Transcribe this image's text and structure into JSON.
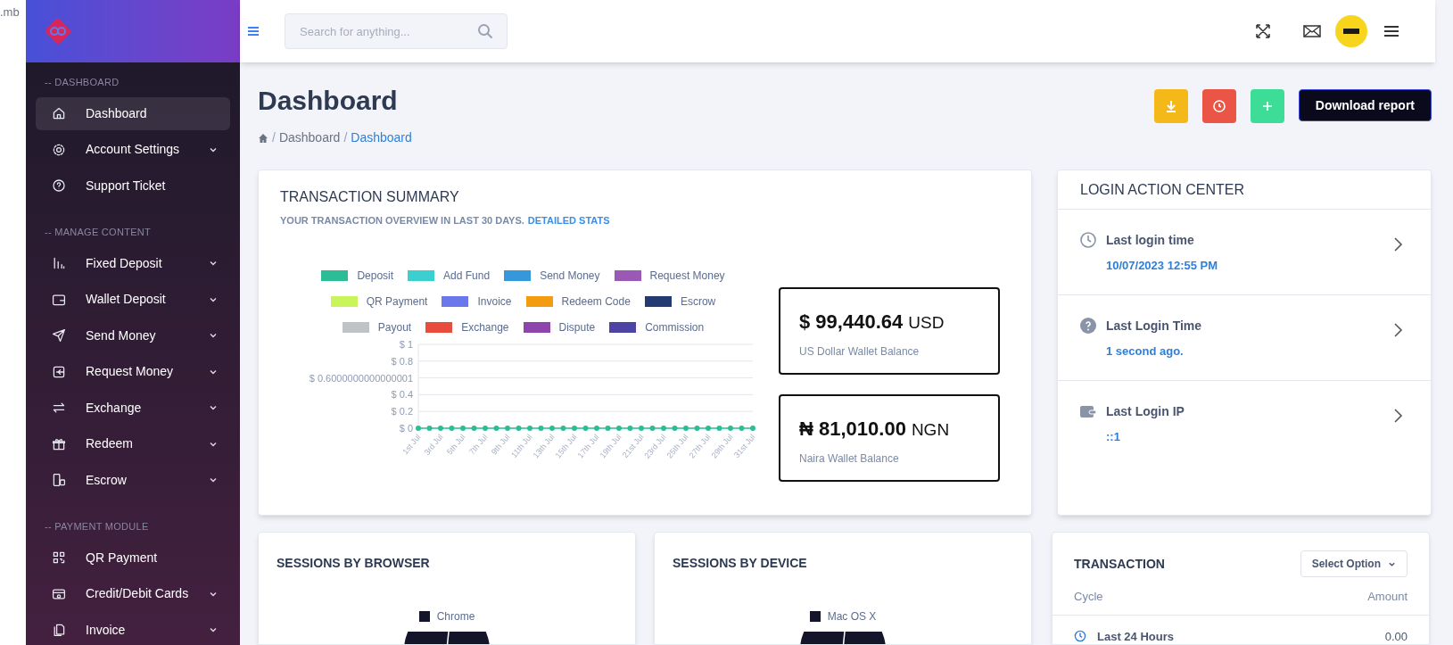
{
  "background_window": {
    "text": ".mb"
  },
  "sidebar": {
    "sections": [
      {
        "heading": "-- DASHBOARD",
        "items": [
          {
            "label": "Dashboard",
            "kind": "home",
            "selected": true,
            "has_submenu": false
          },
          {
            "label": "Account Settings",
            "kind": "gear",
            "selected": false,
            "has_submenu": true
          },
          {
            "label": "Support Ticket",
            "kind": "question",
            "selected": false,
            "has_submenu": false
          }
        ]
      },
      {
        "heading": "-- MANAGE CONTENT",
        "items": [
          {
            "label": "Fixed Deposit",
            "kind": "bars",
            "selected": false,
            "has_submenu": true
          },
          {
            "label": "Wallet Deposit",
            "kind": "wallet",
            "selected": false,
            "has_submenu": true
          },
          {
            "label": "Send Money",
            "kind": "send",
            "selected": false,
            "has_submenu": true
          },
          {
            "label": "Request Money",
            "kind": "request",
            "selected": false,
            "has_submenu": true
          },
          {
            "label": "Exchange",
            "kind": "exchange",
            "selected": false,
            "has_submenu": true
          },
          {
            "label": "Redeem",
            "kind": "gift",
            "selected": false,
            "has_submenu": true
          },
          {
            "label": "Escrow",
            "kind": "escrow",
            "selected": false,
            "has_submenu": true
          }
        ]
      },
      {
        "heading": "-- PAYMENT MODULE",
        "items": [
          {
            "label": "QR Payment",
            "kind": "qr",
            "selected": false,
            "has_submenu": false
          },
          {
            "label": "Credit/Debit Cards",
            "kind": "card",
            "selected": false,
            "has_submenu": true
          },
          {
            "label": "Invoice",
            "kind": "invoice",
            "selected": false,
            "has_submenu": true
          }
        ]
      }
    ]
  },
  "header": {
    "search": {
      "placeholder": "Search for anything..."
    }
  },
  "page": {
    "title": "Dashboard",
    "breadcrumb": [
      {
        "separator": "/",
        "label": "Dashboard"
      },
      {
        "separator": "/",
        "label": "Dashboard"
      }
    ],
    "action_buttons": [
      {
        "kind": "download",
        "color": "#f5b819"
      },
      {
        "kind": "clock",
        "color": "#ea5545"
      },
      {
        "kind": "plus",
        "color": "#3ddc97"
      }
    ],
    "report_button": "Download report"
  },
  "transaction_summary": {
    "title": "TRANSACTION SUMMARY",
    "subtitle": "YOUR TRANSACTION OVERVIEW IN LAST 30 DAYS.",
    "link": "DETAILED STATS",
    "chart_data": {
      "type": "line",
      "categories": [
        "1st Jul",
        null,
        "3rd Jul",
        null,
        "5th Jul",
        null,
        "7th Jul",
        null,
        "9th Jul",
        null,
        "11th Jul",
        null,
        "13th Jul",
        null,
        "15th Jul",
        null,
        "17th Jul",
        null,
        "19th Jul",
        null,
        "21st Jul",
        null,
        "23rd Jul",
        null,
        "25th Jul",
        null,
        "27th Jul",
        null,
        "29th Jul",
        null,
        "31st Jul"
      ],
      "ylim": [
        0,
        1
      ],
      "yticks": [
        {
          "value": 1,
          "label": "$ 1"
        },
        {
          "value": 0.8,
          "label": "$ 0.8"
        },
        {
          "value": 0.6,
          "label": "$ 0.6000000000000001"
        },
        {
          "value": 0.4,
          "label": "$ 0.4"
        },
        {
          "value": 0.2,
          "label": "$ 0.2"
        },
        {
          "value": 0,
          "label": "$ 0"
        }
      ],
      "series": [
        {
          "name": "Deposit",
          "color": "#2dbd96",
          "marker": "circle",
          "values": [
            0,
            0,
            0,
            0,
            0,
            0,
            0,
            0,
            0,
            0,
            0,
            0,
            0,
            0,
            0,
            0,
            0,
            0,
            0,
            0,
            0,
            0,
            0,
            0,
            0,
            0,
            0,
            0,
            0,
            0,
            0
          ]
        },
        {
          "name": "Add Fund",
          "color": "#3ccfcf",
          "values": [
            null,
            null,
            null,
            null,
            null,
            null,
            null,
            null,
            null,
            null,
            null,
            null,
            null,
            null,
            null,
            null,
            null,
            null,
            null,
            null,
            null,
            null,
            null,
            null,
            null,
            null,
            null,
            null,
            null,
            null,
            null
          ]
        },
        {
          "name": "Send Money",
          "color": "#3498db",
          "values": [
            null,
            null,
            null,
            null,
            null,
            null,
            null,
            null,
            null,
            null,
            null,
            null,
            null,
            null,
            null,
            null,
            null,
            null,
            null,
            null,
            null,
            null,
            null,
            null,
            null,
            null,
            null,
            null,
            null,
            null,
            null
          ]
        },
        {
          "name": "Request Money",
          "color": "#9b59b6",
          "values": [
            null,
            null,
            null,
            null,
            null,
            null,
            null,
            null,
            null,
            null,
            null,
            null,
            null,
            null,
            null,
            null,
            null,
            null,
            null,
            null,
            null,
            null,
            null,
            null,
            null,
            null,
            null,
            null,
            null,
            null,
            null
          ]
        },
        {
          "name": "QR Payment",
          "color": "#c9f55b",
          "values": [
            null,
            null,
            null,
            null,
            null,
            null,
            null,
            null,
            null,
            null,
            null,
            null,
            null,
            null,
            null,
            null,
            null,
            null,
            null,
            null,
            null,
            null,
            null,
            null,
            null,
            null,
            null,
            null,
            null,
            null,
            null
          ]
        },
        {
          "name": "Invoice",
          "color": "#6a78ec",
          "values": [
            null,
            null,
            null,
            null,
            null,
            null,
            null,
            null,
            null,
            null,
            null,
            null,
            null,
            null,
            null,
            null,
            null,
            null,
            null,
            null,
            null,
            null,
            null,
            null,
            null,
            null,
            null,
            null,
            null,
            null,
            null
          ]
        },
        {
          "name": "Redeem Code",
          "color": "#f39c12",
          "values": [
            null,
            null,
            null,
            null,
            null,
            null,
            null,
            null,
            null,
            null,
            null,
            null,
            null,
            null,
            null,
            null,
            null,
            null,
            null,
            null,
            null,
            null,
            null,
            null,
            null,
            null,
            null,
            null,
            null,
            null,
            null
          ]
        },
        {
          "name": "Escrow",
          "color": "#233b70",
          "values": [
            null,
            null,
            null,
            null,
            null,
            null,
            null,
            null,
            null,
            null,
            null,
            null,
            null,
            null,
            null,
            null,
            null,
            null,
            null,
            null,
            null,
            null,
            null,
            null,
            null,
            null,
            null,
            null,
            null,
            null,
            null
          ]
        },
        {
          "name": "Payout",
          "color": "#bdc3c7",
          "values": [
            null,
            null,
            null,
            null,
            null,
            null,
            null,
            null,
            null,
            null,
            null,
            null,
            null,
            null,
            null,
            null,
            null,
            null,
            null,
            null,
            null,
            null,
            null,
            null,
            null,
            null,
            null,
            null,
            null,
            null,
            null
          ]
        },
        {
          "name": "Exchange",
          "color": "#e74c3c",
          "values": [
            null,
            null,
            null,
            null,
            null,
            null,
            null,
            null,
            null,
            null,
            null,
            null,
            null,
            null,
            null,
            null,
            null,
            null,
            null,
            null,
            null,
            null,
            null,
            null,
            null,
            null,
            null,
            null,
            null,
            null,
            null
          ]
        },
        {
          "name": "Dispute",
          "color": "#8e44ad",
          "values": [
            null,
            null,
            null,
            null,
            null,
            null,
            null,
            null,
            null,
            null,
            null,
            null,
            null,
            null,
            null,
            null,
            null,
            null,
            null,
            null,
            null,
            null,
            null,
            null,
            null,
            null,
            null,
            null,
            null,
            null,
            null
          ]
        },
        {
          "name": "Commission",
          "color": "#4e44a6",
          "values": [
            null,
            null,
            null,
            null,
            null,
            null,
            null,
            null,
            null,
            null,
            null,
            null,
            null,
            null,
            null,
            null,
            null,
            null,
            null,
            null,
            null,
            null,
            null,
            null,
            null,
            null,
            null,
            null,
            null,
            null,
            null
          ]
        }
      ],
      "grid": true,
      "legend": true
    },
    "balances": [
      {
        "symbol": "$",
        "amount": "99,440.64",
        "currency": "USD",
        "label": "US Dollar Wallet Balance"
      },
      {
        "symbol": "₦",
        "amount": "81,010.00",
        "currency": "NGN",
        "label": "Naira Wallet Balance"
      }
    ]
  },
  "login_action_center": {
    "title": "LOGIN ACTION CENTER",
    "items": [
      {
        "kind": "clock",
        "label": "Last login time",
        "value": "10/07/2023 12:55 PM"
      },
      {
        "kind": "question",
        "label": "Last Login Time",
        "value": "1 second ago."
      },
      {
        "kind": "wallet",
        "label": "Last Login IP",
        "value": "::1"
      }
    ]
  },
  "sessions": [
    {
      "title": "SESSIONS BY BROWSER",
      "legend": [
        {
          "label": "Chrome",
          "color": "#14142b"
        }
      ]
    },
    {
      "title": "SESSIONS BY DEVICE",
      "legend": [
        {
          "label": "Mac OS X",
          "color": "#14142b"
        }
      ]
    }
  ],
  "transaction": {
    "title": "TRANSACTION",
    "select": "Select Option",
    "columns": [
      "Cycle",
      "Amount"
    ],
    "rows": [
      {
        "cycle": "Last 24 Hours",
        "amount": "0.00"
      }
    ]
  }
}
